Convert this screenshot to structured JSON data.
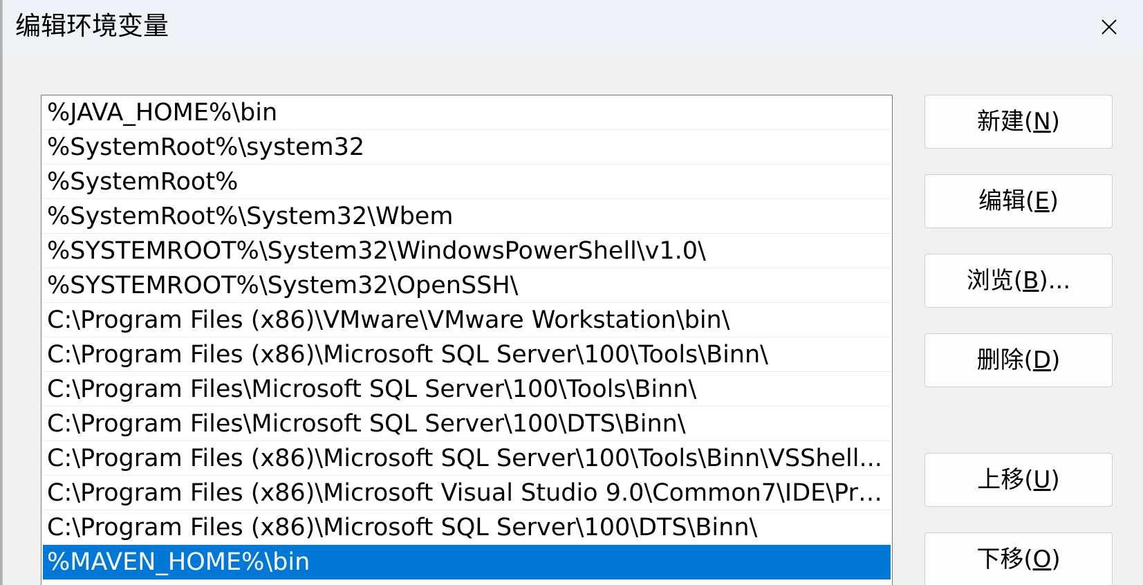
{
  "window": {
    "title": "编辑环境变量"
  },
  "icons": {
    "close": "close-icon"
  },
  "path_list": {
    "items": [
      "%JAVA_HOME%\\bin",
      "%SystemRoot%\\system32",
      "%SystemRoot%",
      "%SystemRoot%\\System32\\Wbem",
      "%SYSTEMROOT%\\System32\\WindowsPowerShell\\v1.0\\",
      "%SYSTEMROOT%\\System32\\OpenSSH\\",
      "C:\\Program Files (x86)\\VMware\\VMware Workstation\\bin\\",
      "C:\\Program Files (x86)\\Microsoft SQL Server\\100\\Tools\\Binn\\",
      "C:\\Program Files\\Microsoft SQL Server\\100\\Tools\\Binn\\",
      "C:\\Program Files\\Microsoft SQL Server\\100\\DTS\\Binn\\",
      "C:\\Program Files (x86)\\Microsoft SQL Server\\100\\Tools\\Binn\\VSShell...",
      "C:\\Program Files (x86)\\Microsoft Visual Studio 9.0\\Common7\\IDE\\Pri...",
      "C:\\Program Files (x86)\\Microsoft SQL Server\\100\\DTS\\Binn\\",
      "%MAVEN_HOME%\\bin"
    ],
    "selected_index": 13
  },
  "buttons": {
    "new": {
      "label": "新建(",
      "key": "N",
      "suffix": ")"
    },
    "edit": {
      "label": "编辑(",
      "key": "E",
      "suffix": ")"
    },
    "browse": {
      "label": "浏览(",
      "key": "B",
      "suffix": ")..."
    },
    "delete": {
      "label": "删除(",
      "key": "D",
      "suffix": ")"
    },
    "move_up": {
      "label": "上移(",
      "key": "U",
      "suffix": ")"
    },
    "move_down": {
      "label": "下移(",
      "key": "O",
      "suffix": ")"
    }
  },
  "colors": {
    "selection": "#0078d7",
    "titlebar": "#eff3f8",
    "window_bg": "#f0f0f0"
  }
}
